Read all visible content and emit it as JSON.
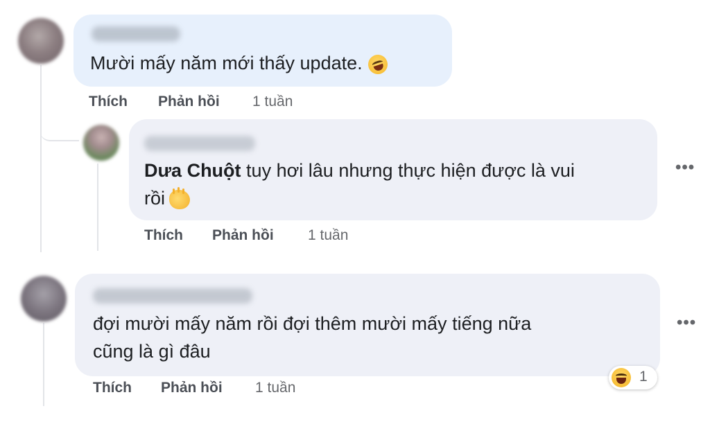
{
  "comments": [
    {
      "text": "Mười mấy năm mới thấy update.",
      "emoji": "laughing-emoji",
      "actions": {
        "like": "Thích",
        "reply": "Phản hồi",
        "time": "1 tuần"
      }
    },
    {
      "mention": "Dưa Chuột",
      "text_line1": " tuy hơi lâu nhưng thực hiện được là vui",
      "text_line2": "rồi",
      "emoji": "clapping-emoji",
      "actions": {
        "like": "Thích",
        "reply": "Phản hồi",
        "time": "1 tuần"
      },
      "more": "•••"
    },
    {
      "text_line1": "đợi mười mấy năm rồi đợi thêm mười mấy tiếng nữa",
      "text_line2": "cũng là gì đâu",
      "actions": {
        "like": "Thích",
        "reply": "Phản hồi",
        "time": "1 tuần"
      },
      "more": "•••",
      "reaction": {
        "icon": "haha-reaction-icon",
        "count": "1"
      }
    }
  ]
}
